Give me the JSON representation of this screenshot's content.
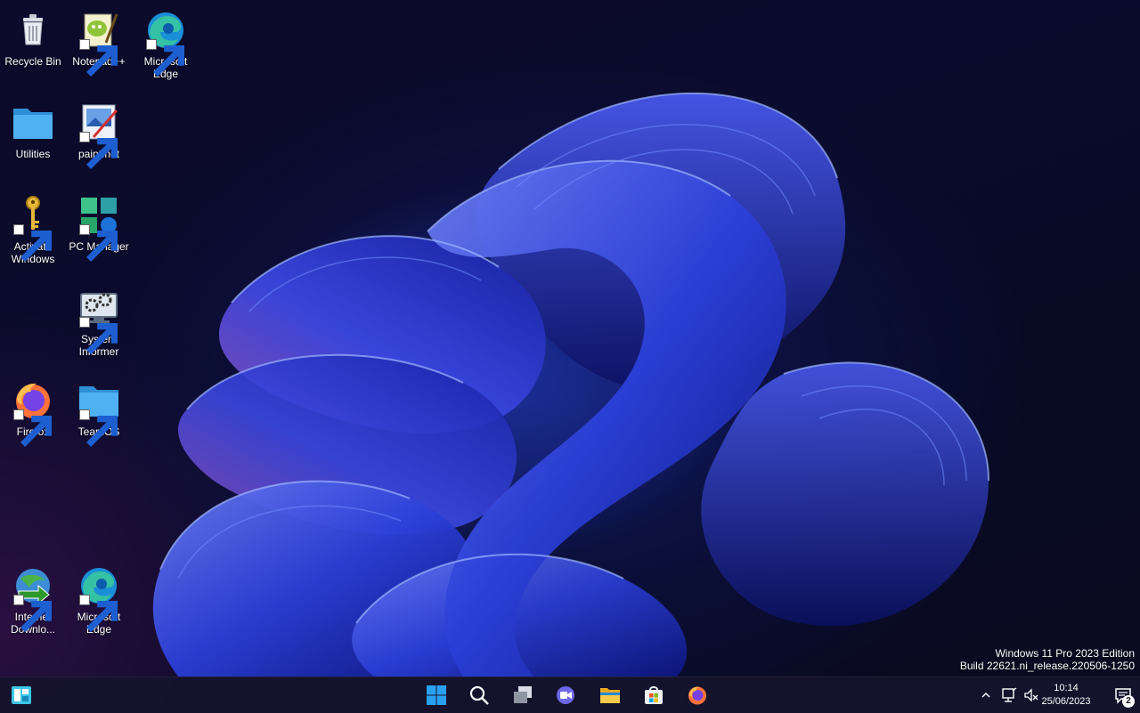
{
  "desktop": {
    "icons": [
      {
        "label": "Recycle Bin"
      },
      {
        "label": "Notepad++"
      },
      {
        "label": "Microsoft Edge"
      },
      {
        "label": "Utilities"
      },
      {
        "label": "paint.net"
      },
      {
        "label": "Activate Windows"
      },
      {
        "label": "PC Manager"
      },
      {
        "label": "System Informer"
      },
      {
        "label": "Firefox"
      },
      {
        "label": "TeamOS"
      },
      {
        "label": "Internet Downlo..."
      },
      {
        "label": "Microsoft Edge"
      }
    ],
    "watermark": {
      "line1": "Windows 11 Pro 2023 Edition",
      "line2": "Build 22621.ni_release.220506-1250"
    }
  },
  "taskbar": {
    "pinned": [
      "windows-start",
      "search",
      "task-view",
      "chat",
      "file-explorer",
      "microsoft-store",
      "firefox"
    ],
    "clock": {
      "time": "10:14",
      "date": "25/06/2023"
    },
    "notification_count": "2"
  },
  "colors": {
    "accent": "#3f7cf0",
    "taskbar_bg": "#16142c",
    "folder": "#4fb0f2"
  }
}
